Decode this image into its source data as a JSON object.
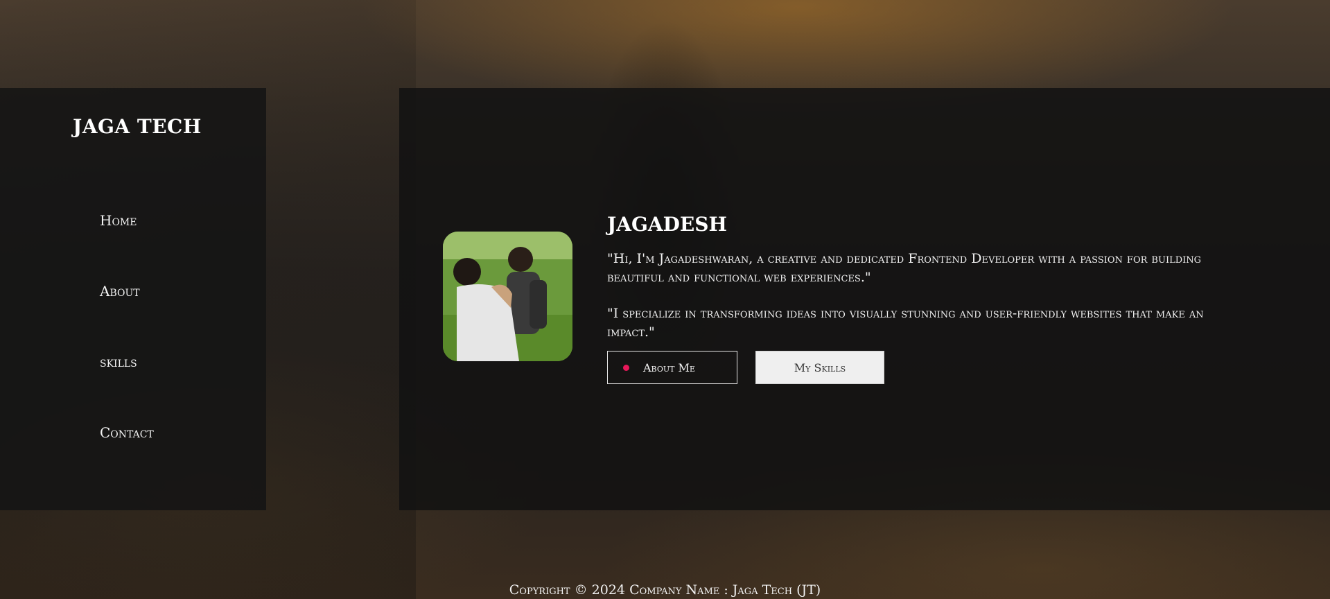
{
  "brand": "JAGA TECH",
  "nav": {
    "items": [
      {
        "label": "Home"
      },
      {
        "label": "About"
      },
      {
        "label": "skills"
      },
      {
        "label": "Contact"
      }
    ]
  },
  "profile": {
    "name": "JAGADESH",
    "quote1": "\"Hi, I'm Jagadeshwaran, a creative and dedicated Frontend Developer with a passion for building beautiful and functional web experiences.\"",
    "quote2": "\"I specialize in transforming ideas into visually stunning and user-friendly websites that make an impact.\"",
    "buttons": {
      "about_label": "About Me",
      "skills_label": "My Skills"
    }
  },
  "footer": {
    "text": "Copyright © 2024 Company Name : Jaga Tech (JT)"
  },
  "colors": {
    "accent_dot": "#e8185a",
    "panel": "#141414",
    "skills_button_bg": "#efefef"
  }
}
